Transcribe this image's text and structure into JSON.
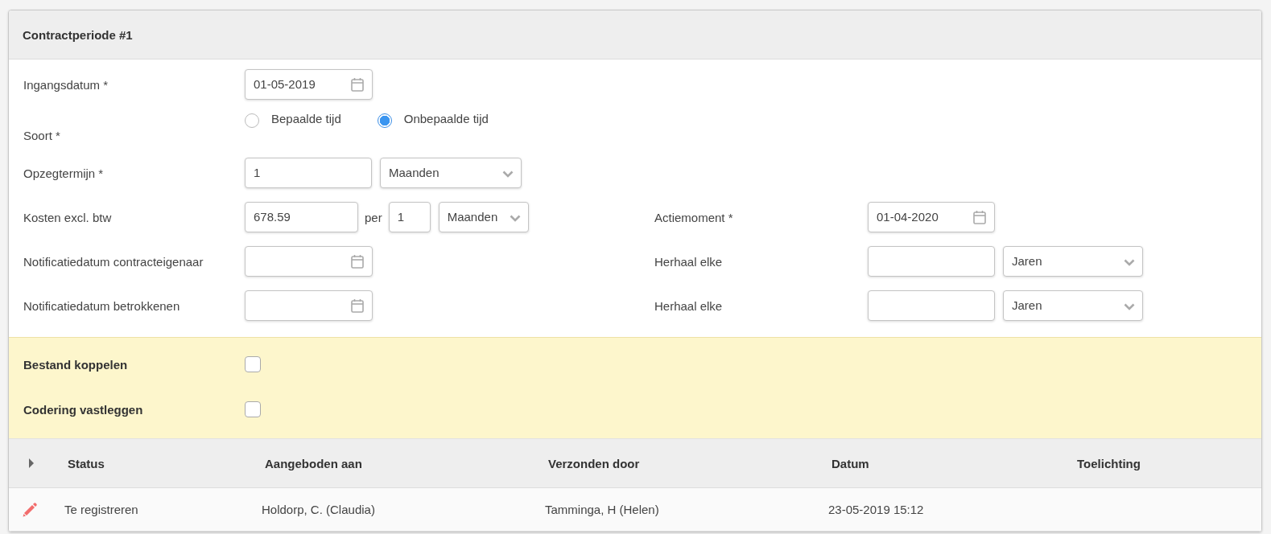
{
  "panel": {
    "title": "Contractperiode #1"
  },
  "form": {
    "ingangsdatum": {
      "label": "Ingangsdatum *",
      "value": "01-05-2019"
    },
    "soort": {
      "label": "Soort *",
      "options": [
        {
          "label": "Bepaalde tijd",
          "selected": false
        },
        {
          "label": "Onbepaalde tijd",
          "selected": true
        }
      ]
    },
    "opzegtermijn": {
      "label": "Opzegtermijn *",
      "value": "1",
      "unit": "Maanden"
    },
    "kosten": {
      "label": "Kosten excl. btw",
      "value": "678.59",
      "per_label": "per",
      "per_value": "1",
      "unit": "Maanden"
    },
    "notificatie_contracteigenaar": {
      "label": "Notificatiedatum contracteigenaar"
    },
    "notificatie_betrokkenen": {
      "label": "Notificatiedatum betrokkenen"
    },
    "actiemoment": {
      "label": "Actiemoment *",
      "value": "01-04-2020"
    },
    "herhaal": [
      {
        "label": "Herhaal elke",
        "unit": "Jaren"
      },
      {
        "label": "Herhaal elke",
        "unit": "Jaren"
      }
    ]
  },
  "options": [
    {
      "label": "Bestand koppelen",
      "checked": false
    },
    {
      "label": "Codering vastleggen",
      "checked": false
    }
  ],
  "table": {
    "expanded": false,
    "columns": [
      "Status",
      "Aangeboden aan",
      "Verzonden door",
      "Datum",
      "Toelichting"
    ],
    "rows": [
      {
        "cells": [
          "Te registreren",
          "Holdorp, C. (Claudia)",
          "Tamminga, H (Helen)",
          "23-05-2019 15:12"
        ]
      }
    ]
  }
}
